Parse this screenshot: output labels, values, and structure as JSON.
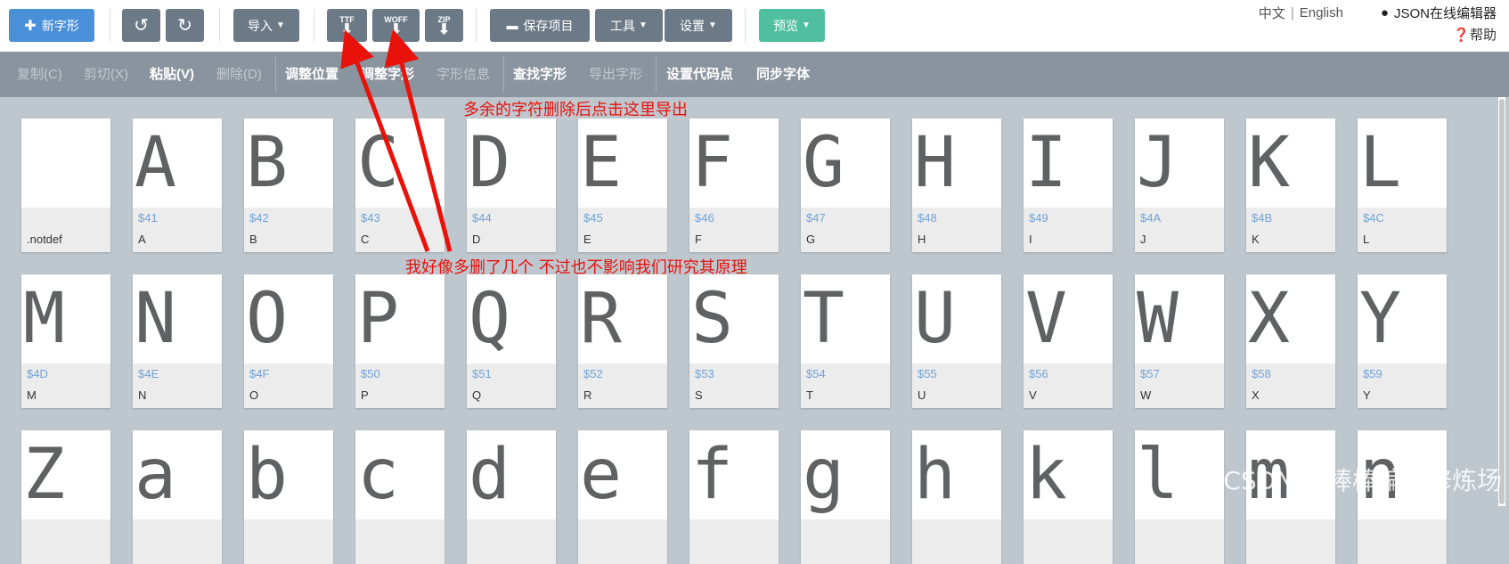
{
  "toolbar_top": {
    "new_glyph": "新字形",
    "import": "导入",
    "ttf": "TTF",
    "woff": "WOFF",
    "zip": "ZIP",
    "save_project": "保存项目",
    "tools": "工具",
    "settings": "设置",
    "preview": "预览",
    "lang_zh": "中文",
    "lang_sep": "|",
    "lang_en": "English",
    "json_editor": "JSON在线编辑器",
    "help": "帮助"
  },
  "toolbar_edit": {
    "copy": "复制(C)",
    "cut": "剪切(X)",
    "paste": "粘贴(V)",
    "delete": "删除(D)",
    "adjust_position": "调整位置",
    "adjust_glyph": "调整字形",
    "glyph_info": "字形信息",
    "find_glyph": "查找字形",
    "export_glyph": "导出字形",
    "set_codepoint": "设置代码点",
    "sync_font": "同步字体"
  },
  "glyphs": [
    {
      "char": "",
      "code": "",
      "name": ".notdef"
    },
    {
      "char": "A",
      "code": "$41",
      "name": "A"
    },
    {
      "char": "B",
      "code": "$42",
      "name": "B"
    },
    {
      "char": "C",
      "code": "$43",
      "name": "C"
    },
    {
      "char": "D",
      "code": "$44",
      "name": "D"
    },
    {
      "char": "E",
      "code": "$45",
      "name": "E"
    },
    {
      "char": "F",
      "code": "$46",
      "name": "F"
    },
    {
      "char": "G",
      "code": "$47",
      "name": "G"
    },
    {
      "char": "H",
      "code": "$48",
      "name": "H"
    },
    {
      "char": "I",
      "code": "$49",
      "name": "I"
    },
    {
      "char": "J",
      "code": "$4A",
      "name": "J"
    },
    {
      "char": "K",
      "code": "$4B",
      "name": "K"
    },
    {
      "char": "L",
      "code": "$4C",
      "name": "L"
    },
    {
      "char": "M",
      "code": "$4D",
      "name": "M"
    },
    {
      "char": "N",
      "code": "$4E",
      "name": "N"
    },
    {
      "char": "O",
      "code": "$4F",
      "name": "O"
    },
    {
      "char": "P",
      "code": "$50",
      "name": "P"
    },
    {
      "char": "Q",
      "code": "$51",
      "name": "Q"
    },
    {
      "char": "R",
      "code": "$52",
      "name": "R"
    },
    {
      "char": "S",
      "code": "$53",
      "name": "S"
    },
    {
      "char": "T",
      "code": "$54",
      "name": "T"
    },
    {
      "char": "U",
      "code": "$55",
      "name": "U"
    },
    {
      "char": "V",
      "code": "$56",
      "name": "V"
    },
    {
      "char": "W",
      "code": "$57",
      "name": "W"
    },
    {
      "char": "X",
      "code": "$58",
      "name": "X"
    },
    {
      "char": "Y",
      "code": "$59",
      "name": "Y"
    },
    {
      "char": "Z",
      "code": "",
      "name": ""
    },
    {
      "char": "a",
      "code": "",
      "name": ""
    },
    {
      "char": "b",
      "code": "",
      "name": ""
    },
    {
      "char": "c",
      "code": "",
      "name": ""
    },
    {
      "char": "d",
      "code": "",
      "name": ""
    },
    {
      "char": "e",
      "code": "",
      "name": ""
    },
    {
      "char": "f",
      "code": "",
      "name": ""
    },
    {
      "char": "g",
      "code": "",
      "name": ""
    },
    {
      "char": "h",
      "code": "",
      "name": ""
    },
    {
      "char": "k",
      "code": "",
      "name": ""
    },
    {
      "char": "l",
      "code": "",
      "name": ""
    },
    {
      "char": "m",
      "code": "",
      "name": ""
    },
    {
      "char": "n",
      "code": "",
      "name": ""
    }
  ],
  "annotations": {
    "export_note": "多余的字符删除后点击这里导出",
    "deleted_note": "我好像多删了几个 不过也不影响我们研究其原理"
  },
  "watermark": "CSDN @棒棒编程修炼场",
  "colors": {
    "primary": "#4a90d9",
    "preview": "#4fbf9f",
    "button": "#6c7a87",
    "annotation": "#e8120b",
    "codepoint": "#6fa2d8"
  }
}
